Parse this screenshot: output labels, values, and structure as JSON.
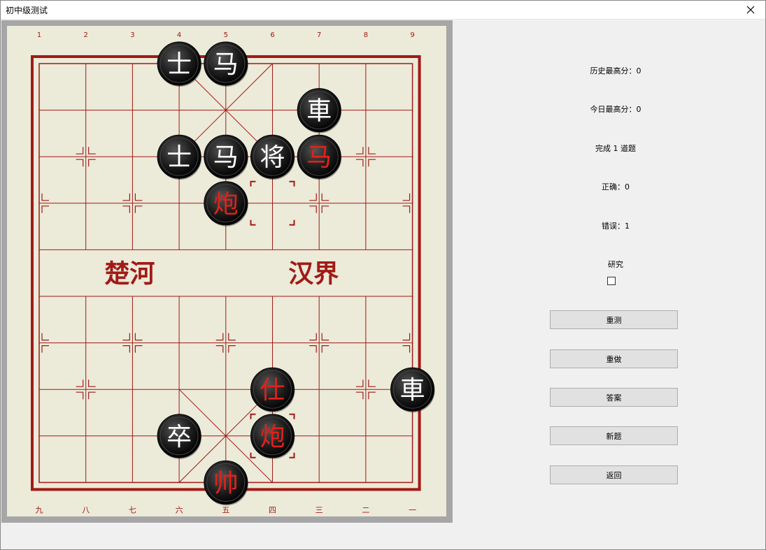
{
  "window": {
    "title": "初中级测试"
  },
  "board": {
    "top_labels": [
      "1",
      "2",
      "3",
      "4",
      "5",
      "6",
      "7",
      "8",
      "9"
    ],
    "bottom_labels": [
      "九",
      "八",
      "七",
      "六",
      "五",
      "四",
      "三",
      "二",
      "一"
    ],
    "river_left": "楚河",
    "river_right": "汉界",
    "pieces": [
      {
        "col": 4,
        "row": 0,
        "label": "士",
        "side": "black"
      },
      {
        "col": 5,
        "row": 0,
        "label": "马",
        "side": "black"
      },
      {
        "col": 7,
        "row": 1,
        "label": "車",
        "side": "black"
      },
      {
        "col": 4,
        "row": 2,
        "label": "士",
        "side": "black"
      },
      {
        "col": 5,
        "row": 2,
        "label": "马",
        "side": "black"
      },
      {
        "col": 6,
        "row": 2,
        "label": "将",
        "side": "black"
      },
      {
        "col": 7,
        "row": 2,
        "label": "马",
        "side": "red"
      },
      {
        "col": 5,
        "row": 3,
        "label": "炮",
        "side": "red"
      },
      {
        "col": 6,
        "row": 7,
        "label": "仕",
        "side": "red"
      },
      {
        "col": 9,
        "row": 7,
        "label": "車",
        "side": "black"
      },
      {
        "col": 4,
        "row": 8,
        "label": "卒",
        "side": "black"
      },
      {
        "col": 6,
        "row": 8,
        "label": "炮",
        "side": "red"
      },
      {
        "col": 5,
        "row": 9,
        "label": "帅",
        "side": "red"
      }
    ],
    "highlights": [
      {
        "col": 6,
        "row": 3
      },
      {
        "col": 6,
        "row": 8
      }
    ]
  },
  "stats": {
    "history_best": "历史最高分：0",
    "today_best": "今日最高分：0",
    "completed": "完成 1 道题",
    "correct": "正确：0",
    "wrong": "错误：1",
    "research_label": "研究"
  },
  "buttons": {
    "retest": "重测",
    "redo": "重做",
    "answer": "答案",
    "new_problem": "新题",
    "back": "返回"
  }
}
